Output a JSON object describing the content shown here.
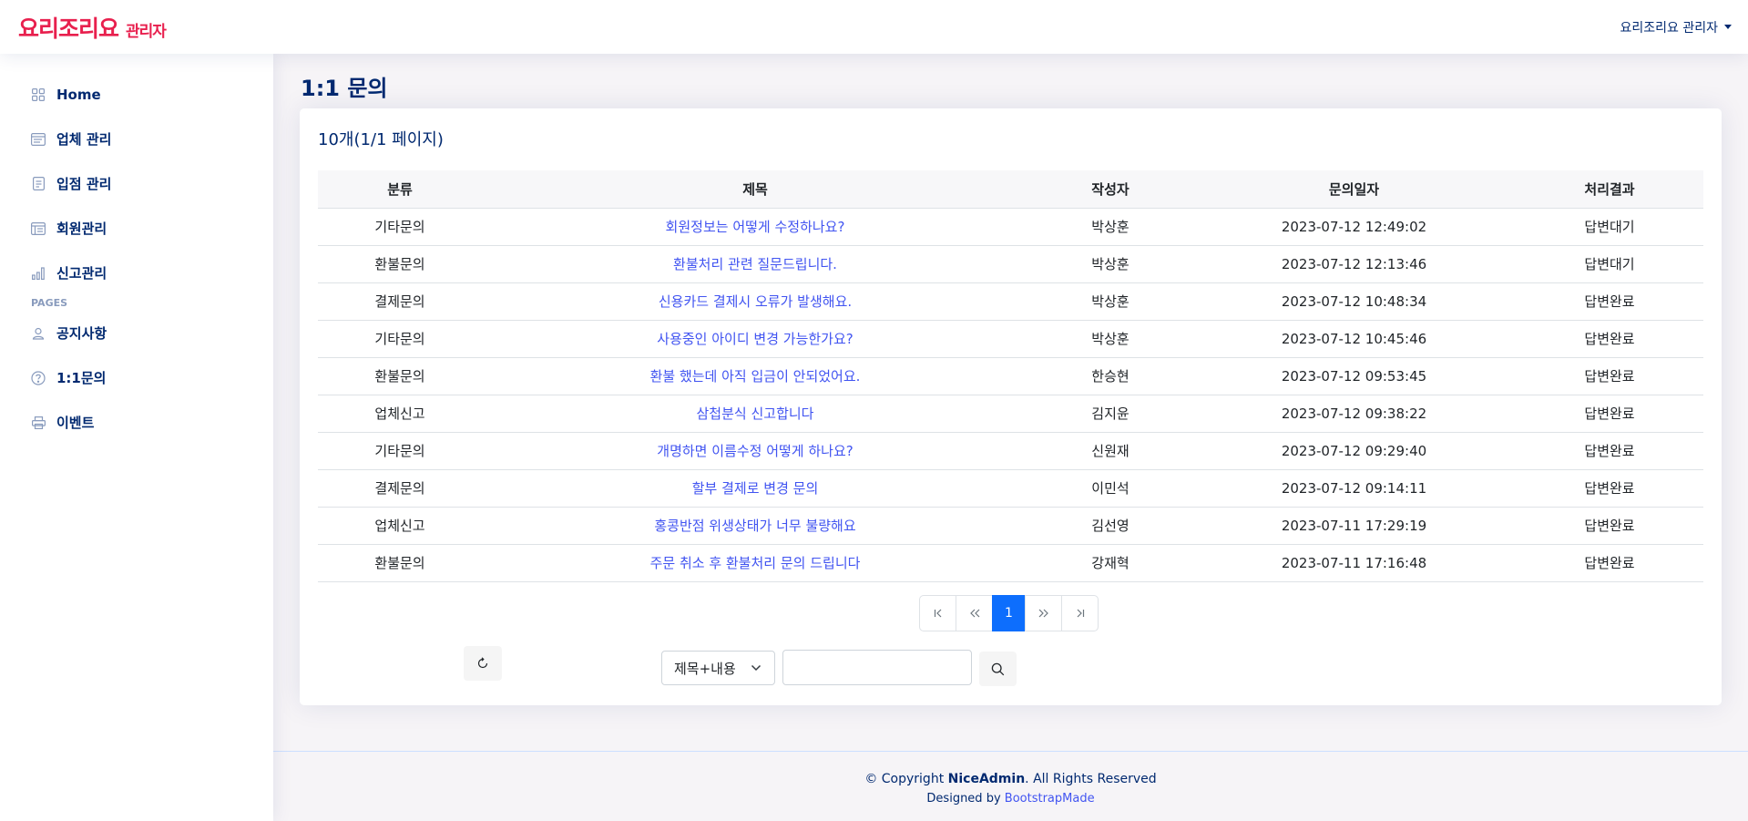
{
  "header": {
    "logo_main": "요리조리요",
    "logo_sub": "관리자",
    "profile_name": "요리조리요 관리자"
  },
  "sidebar": {
    "items": [
      {
        "label": "Home",
        "icon": "grid-icon"
      },
      {
        "label": "업체 관리",
        "icon": "layout-text-sidebar-icon"
      },
      {
        "label": "입점 관리",
        "icon": "journal-text-icon"
      },
      {
        "label": "회원관리",
        "icon": "layout-text-window-icon"
      },
      {
        "label": "신고관리",
        "icon": "bar-chart-icon"
      }
    ],
    "heading": "PAGES",
    "pages": [
      {
        "label": "공지사항",
        "icon": "person-icon"
      },
      {
        "label": "1:1문의",
        "icon": "question-circle-icon"
      },
      {
        "label": "이벤트",
        "icon": "printer-icon"
      }
    ]
  },
  "page": {
    "title": "1:1 문의",
    "count_text": "10개(1/1 페이지)"
  },
  "table": {
    "headers": [
      "분류",
      "제목",
      "작성자",
      "문의일자",
      "처리결과"
    ],
    "rows": [
      {
        "category": "기타문의",
        "title": "회원정보는 어떻게 수정하나요?",
        "writer": "박상훈",
        "date": "2023-07-12 12:49:02",
        "result": "답변대기"
      },
      {
        "category": "환불문의",
        "title": "환불처리 관련 질문드립니다.",
        "writer": "박상훈",
        "date": "2023-07-12 12:13:46",
        "result": "답변대기"
      },
      {
        "category": "결제문의",
        "title": "신용카드 결제시 오류가 발생해요.",
        "writer": "박상훈",
        "date": "2023-07-12 10:48:34",
        "result": "답변완료"
      },
      {
        "category": "기타문의",
        "title": "사용중인 아이디 변경 가능한가요?",
        "writer": "박상훈",
        "date": "2023-07-12 10:45:46",
        "result": "답변완료"
      },
      {
        "category": "환불문의",
        "title": "환불 했는데 아직 입금이 안되었어요.",
        "writer": "한승현",
        "date": "2023-07-12 09:53:45",
        "result": "답변완료"
      },
      {
        "category": "업체신고",
        "title": "삼첩분식 신고합니다",
        "writer": "김지윤",
        "date": "2023-07-12 09:38:22",
        "result": "답변완료"
      },
      {
        "category": "기타문의",
        "title": "개명하면 이름수정 어떻게 하나요?",
        "writer": "신원재",
        "date": "2023-07-12 09:29:40",
        "result": "답변완료"
      },
      {
        "category": "결제문의",
        "title": "할부 결제로 변경 문의",
        "writer": "이민석",
        "date": "2023-07-12 09:14:11",
        "result": "답변완료"
      },
      {
        "category": "업체신고",
        "title": "홍콩반점 위생상태가 너무 불량해요",
        "writer": "김선영",
        "date": "2023-07-11 17:29:19",
        "result": "답변완료"
      },
      {
        "category": "환불문의",
        "title": "주문 취소 후 환불처리 문의 드립니다",
        "writer": "강재혁",
        "date": "2023-07-11 17:16:48",
        "result": "답변완료"
      }
    ]
  },
  "pagination": {
    "current_page": "1"
  },
  "search": {
    "select_value": "제목+내용",
    "input_value": ""
  },
  "footer": {
    "copyright_prefix": "© Copyright",
    "brand": "NiceAdmin",
    "copyright_suffix": ". All Rights Reserved",
    "designed_by": "Designed by",
    "designer": "BootstrapMade"
  },
  "colors": {
    "brand": "#e8204e",
    "nav_text": "#012970",
    "link": "#4154f1",
    "active_page": "#0d6efd"
  }
}
